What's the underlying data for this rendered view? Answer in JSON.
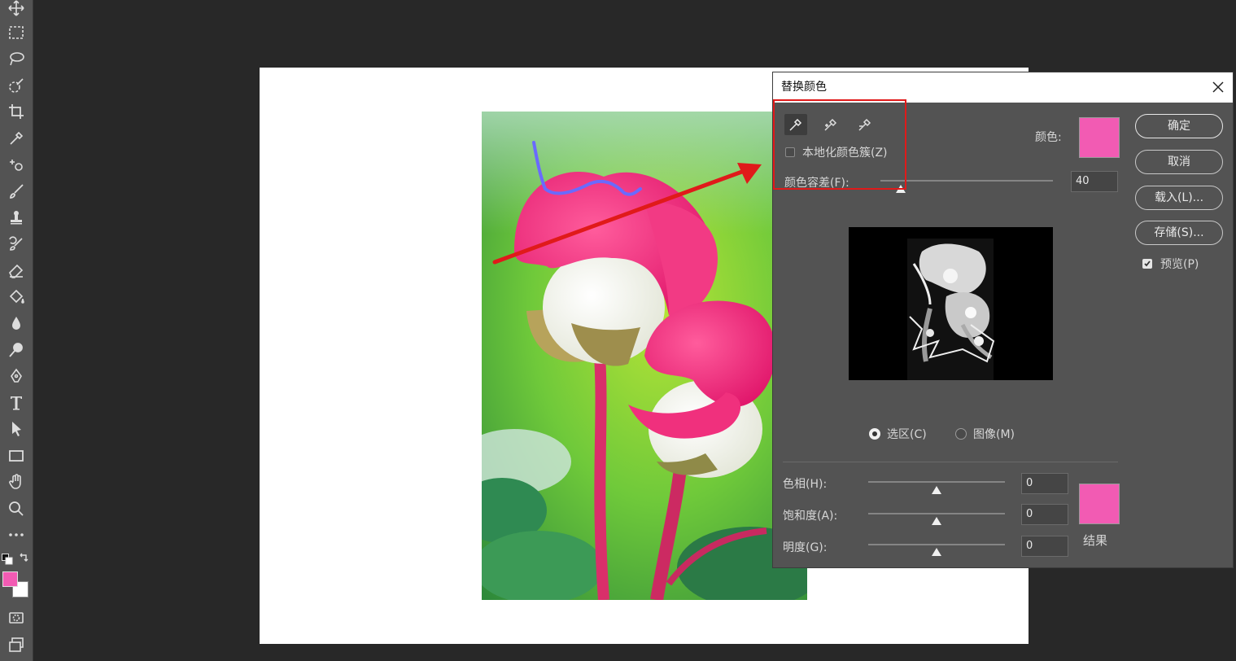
{
  "toolbar": {
    "tools": [
      "move-icon",
      "marquee-icon",
      "lasso-icon",
      "quick-select-icon",
      "crop-icon",
      "eyedropper-icon",
      "healing-icon",
      "brush-icon",
      "stamp-icon",
      "history-brush-icon",
      "eraser-icon",
      "paint-bucket-icon",
      "blur-icon",
      "dodge-icon",
      "pen-icon",
      "type-icon",
      "path-select-icon",
      "rectangle-icon",
      "hand-icon",
      "zoom-icon",
      "more-icon"
    ],
    "foreground_color": "#f25bb3",
    "background_color": "#ffffff"
  },
  "dialog": {
    "title": "替换颜色",
    "localized_label": "本地化颜色簇(Z)",
    "color_label": "颜色:",
    "color_value": "#f25bb3",
    "fuzziness_label": "颜色容差(F):",
    "fuzziness_value": "40",
    "fuzziness_level": 0.12,
    "radio_selection": "选区(C)",
    "radio_image": "图像(M)",
    "hue_label": "色相(H):",
    "hue_value": "0",
    "saturation_label": "饱和度(A):",
    "saturation_value": "0",
    "lightness_label": "明度(G):",
    "lightness_value": "0",
    "result_label": "结果",
    "result_color": "#f25bb3",
    "buttons": {
      "ok": "确定",
      "cancel": "取消",
      "load": "载入(L)...",
      "save": "存储(S)..."
    },
    "preview_label": "预览(P)",
    "preview_checked": true,
    "localized_checked": false
  },
  "annotation": {
    "highlight_color": "#e01a1a"
  }
}
